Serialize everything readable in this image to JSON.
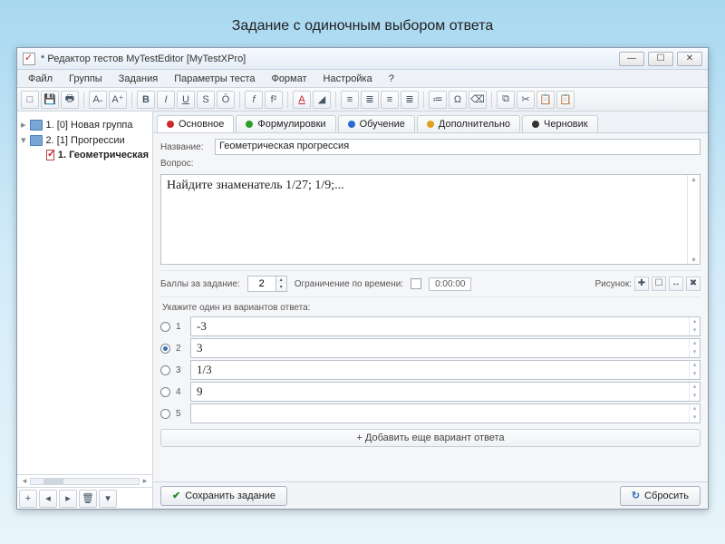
{
  "slide_title": "Задание с одиночным выбором ответа",
  "window": {
    "title": "* Редактор тестов MyTestEditor [MyTestXPro]",
    "controls": {
      "min": "—",
      "max": "☐",
      "close": "✕"
    }
  },
  "menu": [
    "Файл",
    "Группы",
    "Задания",
    "Параметры теста",
    "Формат",
    "Настройка",
    "?"
  ],
  "tree": {
    "item1": "1. [0] Новая группа",
    "item2": "2. [1] Прогрессии",
    "item3": "1. Геометрическая"
  },
  "tabs": [
    {
      "label": "Основное",
      "color": "#d02828"
    },
    {
      "label": "Формулировки",
      "color": "#2aa02a"
    },
    {
      "label": "Обучение",
      "color": "#2a6ad0"
    },
    {
      "label": "Дополнительно",
      "color": "#e0a020"
    },
    {
      "label": "Черновик",
      "color": "#333333"
    }
  ],
  "fields": {
    "name_label": "Название:",
    "name_value": "Геометрическая прогрессия",
    "question_label": "Вопрос:",
    "question_text": "Найдите знаменатель 1/27; 1/9;..."
  },
  "midbar": {
    "points_label": "Баллы за задание:",
    "points_value": "2",
    "timelimit_label": "Ограничение по времени:",
    "time_value": "0:00:00",
    "image_label": "Рисунок:"
  },
  "answers": {
    "hint": "Укажите один из вариантов ответа:",
    "items": [
      {
        "num": "1",
        "text": "-3",
        "checked": false
      },
      {
        "num": "2",
        "text": "3",
        "checked": true
      },
      {
        "num": "3",
        "text": "1/3",
        "checked": false
      },
      {
        "num": "4",
        "text": "9",
        "checked": false
      },
      {
        "num": "5",
        "text": "",
        "checked": false
      }
    ]
  },
  "add_answer": "+  Добавить еще вариант ответа",
  "buttons": {
    "save": "Сохранить задание",
    "reset": "Сбросить"
  }
}
